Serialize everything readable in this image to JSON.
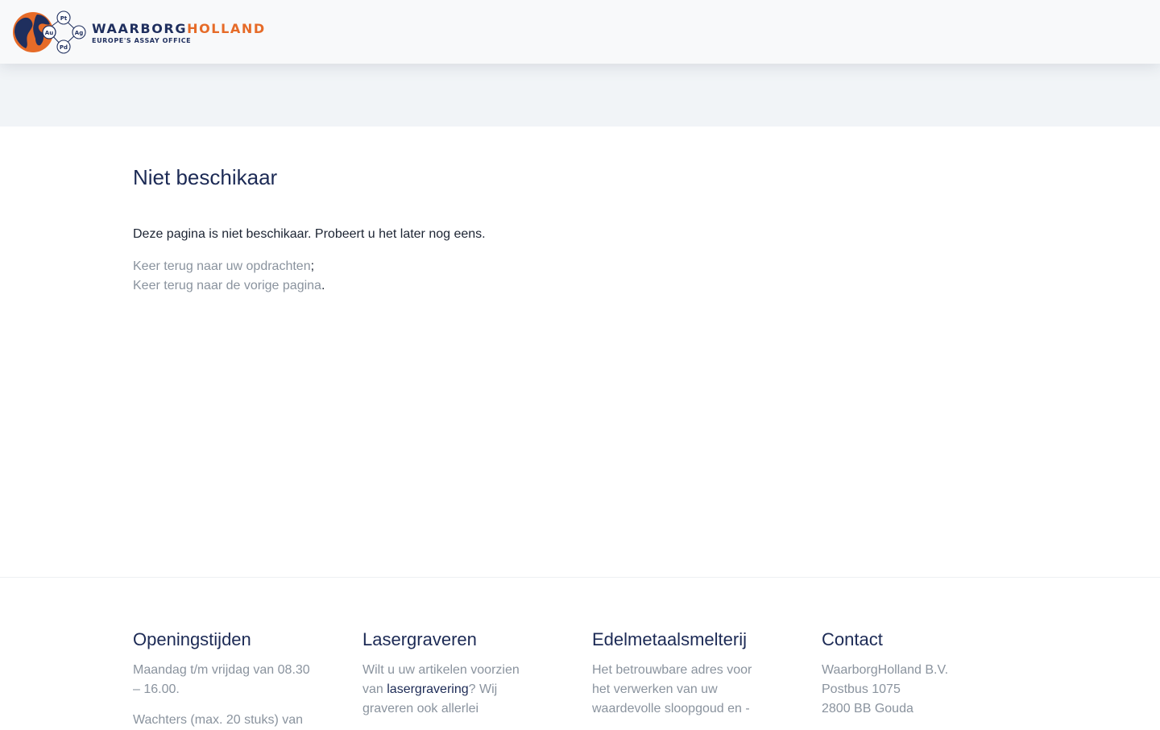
{
  "header": {
    "logo": {
      "brand_part1": "WAARBORG",
      "brand_part2": "HOLLAND",
      "tagline": "EUROPE'S ASSAY OFFICE",
      "elements": [
        "Au",
        "Pt",
        "Ag",
        "Pd"
      ]
    }
  },
  "main": {
    "title": "Niet beschikaar",
    "message": "Deze pagina is niet beschikaar. Probeert u het later nog eens.",
    "links": [
      {
        "label": "Keer terug naar uw opdrachten",
        "suffix": ";"
      },
      {
        "label": "Keer terug naar de vorige pagina",
        "suffix": "."
      }
    ]
  },
  "footer": {
    "openingstijden": {
      "title": "Openingstijden",
      "text1": "Maandag t/m vrijdag van 08.30 – 16.00.",
      "text2": "Wachters (max. 20 stuks) van"
    },
    "lasergraveren": {
      "title": "Lasergraveren",
      "text_before": "Wilt u uw artikelen voorzien van ",
      "link": "lasergravering",
      "text_after": "? Wij graveren ook allerlei"
    },
    "edelmetaal": {
      "title": "Edelmetaalsmelterij",
      "text": "Het betrouwbare adres voor het verwerken van uw waardevolle sloopgoud en -"
    },
    "contact": {
      "title": "Contact",
      "lines": [
        "WaarborgHolland B.V.",
        "Postbus 1075",
        "2800 BB Gouda"
      ]
    }
  },
  "colors": {
    "navy": "#1c2a55",
    "orange": "#e66b28",
    "muted_text": "#8a939e",
    "header_bg": "#f8f9fa",
    "band_bg": "#f1f4f7"
  }
}
